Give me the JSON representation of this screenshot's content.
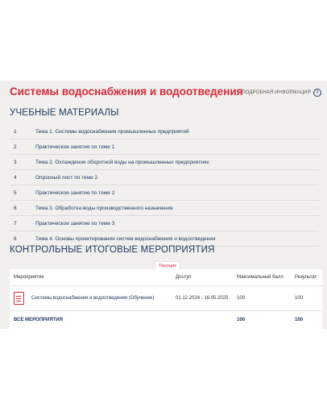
{
  "course": {
    "title": "Системы водоснабжения и водоотведения",
    "more_info": "ПОДРОБНАЯ ИНФОРМАЦИЯ"
  },
  "materials": {
    "title": "УЧЕБНЫЕ МАТЕРИАЛЫ",
    "items": [
      {
        "num": "1",
        "label": "Тема 1. Системы водоснабжения промышленных предприятий"
      },
      {
        "num": "2",
        "label": "Практическое занятие по теме 1"
      },
      {
        "num": "3",
        "label": "Тема 2. Охлаждение оборотной воды на промышленных предприятиях"
      },
      {
        "num": "4",
        "label": "Опросный лист по теме 2"
      },
      {
        "num": "5",
        "label": "Практическое занятие по теме 2"
      },
      {
        "num": "6",
        "label": "Тема 3. Обработка воды производственного назначения"
      },
      {
        "num": "7",
        "label": "Практическое занятие по теме 3"
      },
      {
        "num": "8",
        "label": "Тема 4. Основы проектирования систем водоснабжения и водоотведения"
      }
    ]
  },
  "events": {
    "title": "КОНТРОЛЬНЫЕ ИТОГОВЫЕ МЕРОПРИЯТИЯ",
    "current_tab": "Текущие",
    "columns": [
      "Мероприятие",
      "Доступ",
      "Максимальный балл",
      "Результат"
    ],
    "rows": [
      {
        "name": "Системы водоснабжения и водоотведения (Обучение)",
        "access": "01.12.2024 - 16.05.2025",
        "max": "100",
        "result": "100"
      }
    ],
    "total": {
      "label": "ВСЕ МЕРОПРИЯТИЯ",
      "max": "100",
      "result": "100"
    }
  },
  "colors": {
    "accent": "#d6293a",
    "heading": "#1f3864",
    "panel": "#f1f0ee"
  },
  "icons": {
    "info": "info-icon",
    "event": "document-icon"
  }
}
